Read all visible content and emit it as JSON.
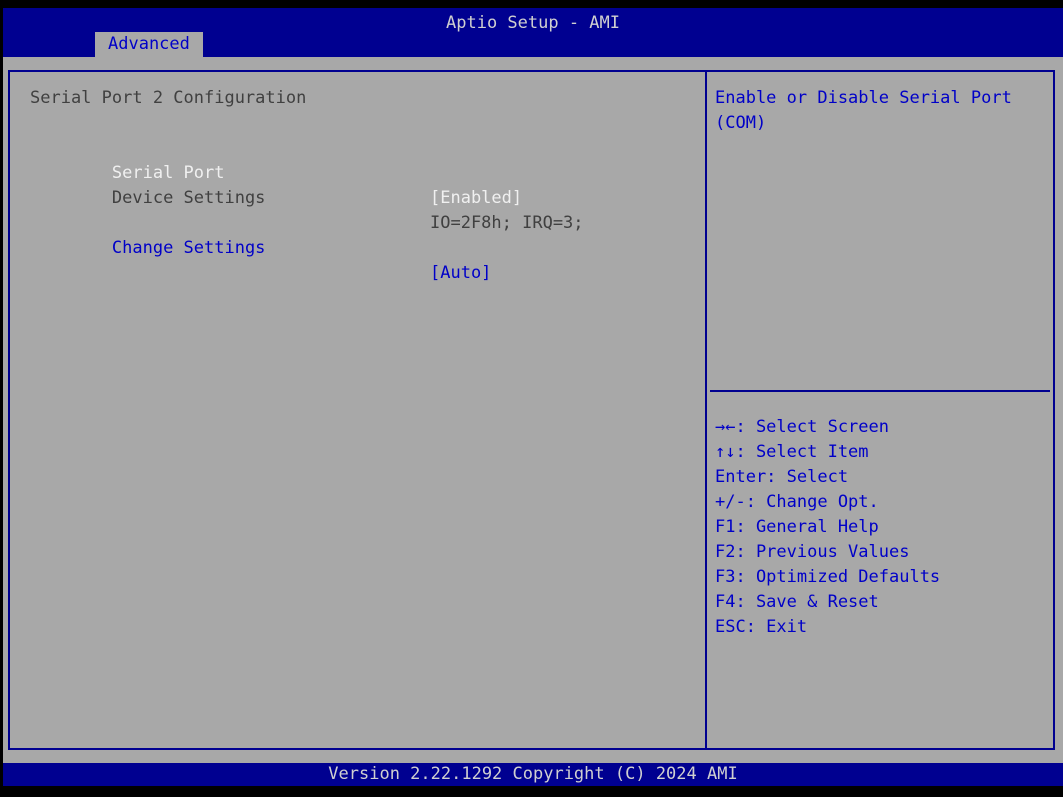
{
  "titlebar": {
    "title": "Aptio Setup - AMI"
  },
  "tabs": [
    {
      "label": "Advanced",
      "active": true
    }
  ],
  "main": {
    "section_title": "Serial Port 2 Configuration",
    "items": [
      {
        "label": "Serial Port",
        "value": "[Enabled]",
        "state": "selected"
      },
      {
        "label": "Device Settings",
        "value": "IO=2F8h; IRQ=3;",
        "state": "info"
      },
      {
        "label": "Change Settings",
        "value": "[Auto]",
        "state": "selectable"
      }
    ]
  },
  "help": {
    "text": "Enable or Disable Serial Port (COM)"
  },
  "hotkeys": [
    "→←: Select Screen",
    "↑↓: Select Item",
    "Enter: Select",
    "+/-: Change Opt.",
    "F1: General Help",
    "F2: Previous Values",
    "F3: Optimized Defaults",
    "F4: Save & Reset",
    "ESC: Exit"
  ],
  "footer": {
    "version_text": "Version 2.22.1292 Copyright (C) 2024 AMI"
  },
  "colors": {
    "bar_blue": "#000090",
    "text_blue": "#0000c8",
    "background_gray": "#a8a8a8",
    "selected_white": "#f0f0f0",
    "info_dark": "#404040",
    "frame_black": "#000000"
  }
}
